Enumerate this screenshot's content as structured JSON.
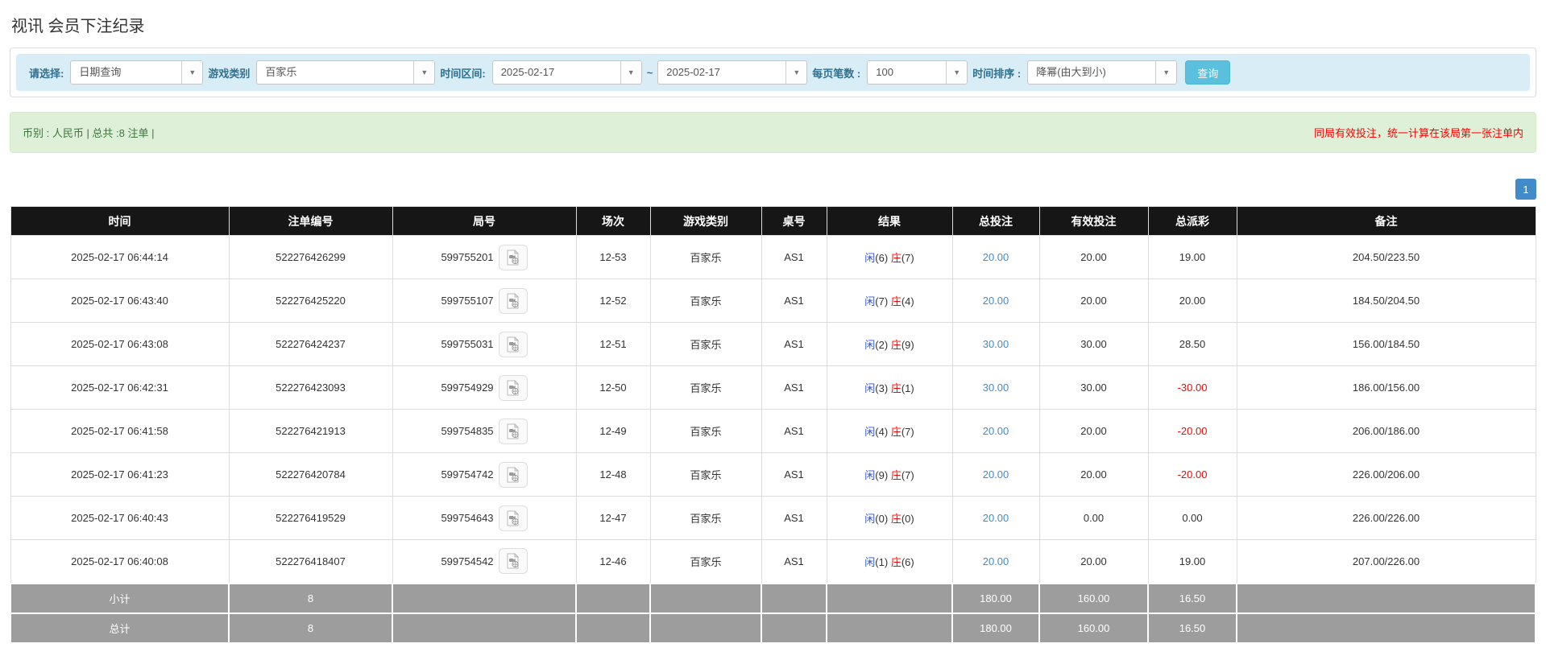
{
  "page": {
    "title": "视讯 会员下注纪录"
  },
  "filters": {
    "select_label": "请选择:",
    "select_value": "日期查询",
    "game_label": "游戏类别",
    "game_value": "百家乐",
    "range_label": "时间区间:",
    "date_from": "2025-02-17",
    "tilde": "~",
    "date_to": "2025-02-17",
    "page_size_label": "每页笔数 :",
    "page_size_value": "100",
    "sort_label": "时间排序 :",
    "sort_value": "降幂(由大到小)",
    "search_button": "查询"
  },
  "summary_bar": {
    "left_text": "币别 : 人民币 | 总共 :8 注单 |",
    "right_text": "同局有效投注，统一计算在该局第一张注单内"
  },
  "pagination": {
    "current": "1"
  },
  "table": {
    "headers": [
      "时间",
      "注单编号",
      "局号",
      "场次",
      "游戏类别",
      "桌号",
      "结果",
      "总投注",
      "有效投注",
      "总派彩",
      "备注"
    ],
    "rows": [
      {
        "time": "2025-02-17 06:44:14",
        "bet_id": "522276426299",
        "round": "599755201",
        "session": "12-53",
        "game": "百家乐",
        "table_no": "AS1",
        "result": {
          "player": "闲(6)",
          "banker": "庄(7)"
        },
        "total_bet": "20.00",
        "valid_bet": "20.00",
        "payout": "19.00",
        "remark": "204.50/223.50"
      },
      {
        "time": "2025-02-17 06:43:40",
        "bet_id": "522276425220",
        "round": "599755107",
        "session": "12-52",
        "game": "百家乐",
        "table_no": "AS1",
        "result": {
          "player": "闲(7)",
          "banker": "庄(4)"
        },
        "total_bet": "20.00",
        "valid_bet": "20.00",
        "payout": "20.00",
        "remark": "184.50/204.50"
      },
      {
        "time": "2025-02-17 06:43:08",
        "bet_id": "522276424237",
        "round": "599755031",
        "session": "12-51",
        "game": "百家乐",
        "table_no": "AS1",
        "result": {
          "player": "闲(2)",
          "banker": "庄(9)"
        },
        "total_bet": "30.00",
        "valid_bet": "30.00",
        "payout": "28.50",
        "remark": "156.00/184.50"
      },
      {
        "time": "2025-02-17 06:42:31",
        "bet_id": "522276423093",
        "round": "599754929",
        "session": "12-50",
        "game": "百家乐",
        "table_no": "AS1",
        "result": {
          "player": "闲(3)",
          "banker": "庄(1)"
        },
        "total_bet": "30.00",
        "valid_bet": "30.00",
        "payout": "-30.00",
        "remark": "186.00/156.00"
      },
      {
        "time": "2025-02-17 06:41:58",
        "bet_id": "522276421913",
        "round": "599754835",
        "session": "12-49",
        "game": "百家乐",
        "table_no": "AS1",
        "result": {
          "player": "闲(4)",
          "banker": "庄(7)"
        },
        "total_bet": "20.00",
        "valid_bet": "20.00",
        "payout": "-20.00",
        "remark": "206.00/186.00"
      },
      {
        "time": "2025-02-17 06:41:23",
        "bet_id": "522276420784",
        "round": "599754742",
        "session": "12-48",
        "game": "百家乐",
        "table_no": "AS1",
        "result": {
          "player": "闲(9)",
          "banker": "庄(7)"
        },
        "total_bet": "20.00",
        "valid_bet": "20.00",
        "payout": "-20.00",
        "remark": "226.00/206.00"
      },
      {
        "time": "2025-02-17 06:40:43",
        "bet_id": "522276419529",
        "round": "599754643",
        "session": "12-47",
        "game": "百家乐",
        "table_no": "AS1",
        "result": {
          "player": "闲(0)",
          "banker": "庄(0)"
        },
        "total_bet": "20.00",
        "valid_bet": "0.00",
        "payout": "0.00",
        "remark": "226.00/226.00"
      },
      {
        "time": "2025-02-17 06:40:08",
        "bet_id": "522276418407",
        "round": "599754542",
        "session": "12-46",
        "game": "百家乐",
        "table_no": "AS1",
        "result": {
          "player": "闲(1)",
          "banker": "庄(6)"
        },
        "total_bet": "20.00",
        "valid_bet": "20.00",
        "payout": "19.00",
        "remark": "207.00/226.00"
      }
    ],
    "subtotal": {
      "label": "小计",
      "count": "8",
      "total_bet": "180.00",
      "valid_bet": "160.00",
      "payout": "16.50"
    },
    "total": {
      "label": "总计",
      "count": "8",
      "total_bet": "180.00",
      "valid_bet": "160.00",
      "payout": "16.50"
    }
  },
  "colors": {
    "header_bg": "#161616",
    "summary_row_bg": "#9d9d9d",
    "filter_bg": "#d9edf7",
    "label_text": "#31708f",
    "success_bg": "#dff0d8",
    "success_text": "#3c763d",
    "warning_text": "#ff0000",
    "link_blue": "#428bca",
    "player_blue": "#3355cc",
    "banker_red": "#ff0000",
    "button_blue": "#5bc0de",
    "pagination_blue": "#428bca"
  }
}
